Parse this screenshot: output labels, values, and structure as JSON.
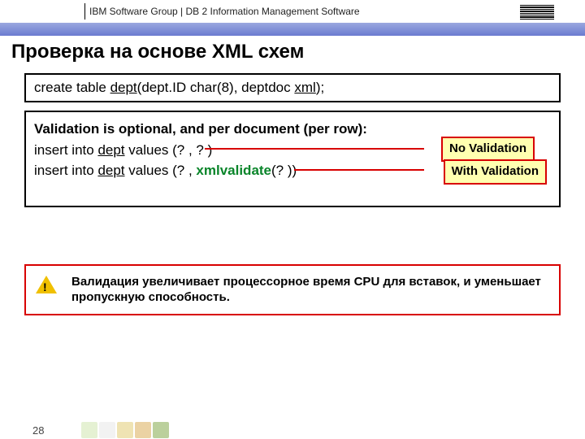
{
  "header": {
    "breadcrumb": "IBM Software Group  |  DB 2 Information Management Software"
  },
  "title": "Проверка на основе XML схем",
  "box1": {
    "t1": "create table ",
    "t2": "dept",
    "t3": "(dept.ID char(8),  deptdoc ",
    "t4": "xml",
    "t5": ");"
  },
  "box2": {
    "line1a": "Validation is optional, and per document (per row):",
    "line2a": "insert into ",
    "line2b": "dept",
    "line2c": " values (? , ? )",
    "line3a": "insert into ",
    "line3b": "dept",
    "line3c": " values (? , ",
    "line3d": "xmlvalidate",
    "line3e": "(? ))",
    "callout1": "No Validation",
    "callout2": "With Validation"
  },
  "alert": {
    "text": "Валидация увеличивает процессорное время CPU для вставок, и уменьшает пропускную способность."
  },
  "page": "28"
}
